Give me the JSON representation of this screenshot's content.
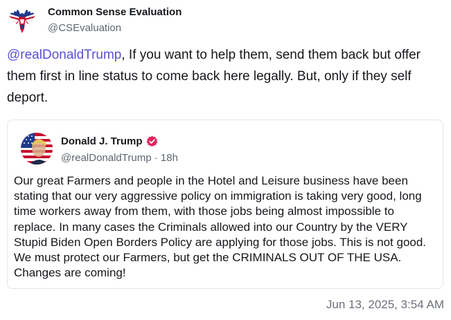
{
  "post": {
    "author": {
      "name": "Common Sense Evaluation",
      "handle": "@CSEvaluation",
      "avatar_icon": "american-flag-eagle-avatar-icon"
    },
    "mention": "@realDonaldTrump",
    "text": ", If you want to help them, send them back but offer them first in line status to come back here legally. But, only if they self deport.",
    "timestamp": "Jun 13, 2025, 3:54 AM"
  },
  "quote": {
    "author": {
      "name": "Donald J. Trump",
      "handle": "@realDonaldTrump",
      "separator": "·",
      "age": "18h",
      "verified_icon": "verified-badge-icon",
      "avatar_icon": "flag-portrait-avatar-icon"
    },
    "text": "Our great Farmers and people in the Hotel and Leisure business have been stating that our very aggressive policy on immigration is taking very good, long time workers away from them, with those jobs being almost impossible to replace. In many cases the Criminals allowed into our Country by the VERY Stupid Biden Open Borders Policy are applying for those jobs. This is not good. We must protect our Farmers, but get the CRIMINALS OUT OF THE USA. Changes are coming!"
  },
  "colors": {
    "mention": "#5b4fd6",
    "verified": "#e0245e",
    "muted_text": "#5f6670",
    "border": "#e3e5ea"
  }
}
